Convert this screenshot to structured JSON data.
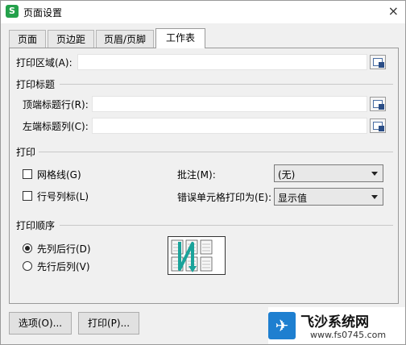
{
  "window": {
    "title": "页面设置",
    "app_icon": "S",
    "close": "×"
  },
  "tabs": [
    "页面",
    "页边距",
    "页眉/页脚",
    "工作表"
  ],
  "print_area": {
    "label": "打印区域(A):",
    "value": ""
  },
  "print_titles": {
    "header": "打印标题",
    "top_rows_label": "顶端标题行(R):",
    "top_rows_value": "",
    "left_cols_label": "左端标题列(C):",
    "left_cols_value": ""
  },
  "print": {
    "header": "打印",
    "gridlines": {
      "label": "网格线(G)",
      "checked": false
    },
    "row_col_headings": {
      "label": "行号列标(L)",
      "checked": false
    },
    "comments_label": "批注(M):",
    "comments_value": "(无)",
    "errors_label": "错误单元格打印为(E):",
    "errors_value": "显示值"
  },
  "print_order": {
    "header": "打印顺序",
    "down_then_over": {
      "label": "先列后行(D)",
      "selected": true
    },
    "over_then_down": {
      "label": "先行后列(V)",
      "selected": false
    }
  },
  "buttons": {
    "options": "选项(O)...",
    "print": "打印(P)..."
  },
  "watermark": {
    "brand": "飞沙系统网",
    "url": "www.fs0745.com"
  },
  "colors": {
    "accent": "#1e7fd0",
    "app_icon": "#24a14b",
    "order_arrow": "#1aa39a"
  }
}
